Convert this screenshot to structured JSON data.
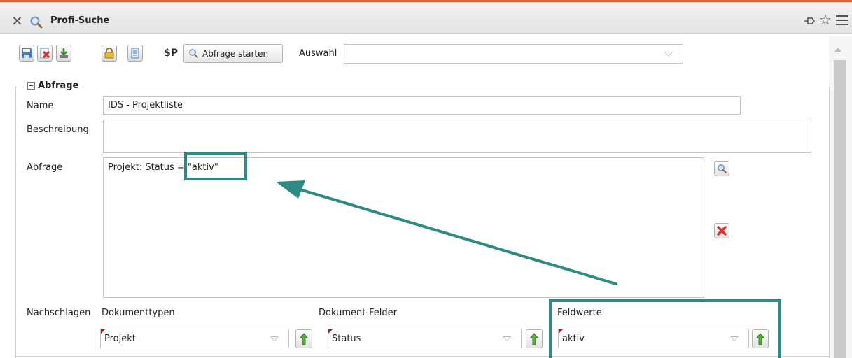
{
  "window": {
    "title": "Profi-Suche",
    "icons": [
      "close-icon",
      "search-icon",
      "pin-icon",
      "star-icon",
      "menu-icon"
    ]
  },
  "toolbar": {
    "dollar_label": "$P",
    "start_label": "Abfrage starten",
    "auswahl_label": "Auswahl",
    "auswahl_value": ""
  },
  "form": {
    "section_title": "Abfrage",
    "name_label": "Name",
    "name_value": "IDS - Projektliste",
    "description_label": "Beschreibung",
    "description_value": "",
    "query_label": "Abfrage",
    "query_value": "Projekt:  Status = \"aktiv\""
  },
  "lookup": {
    "label": "Nachschlagen",
    "doctypes_label": "Dokumenttypen",
    "doctypes_value": "Projekt",
    "docfields_label": "Dokument-Felder",
    "docfields_value": "Status",
    "fieldvalues_label": "Feldwerte",
    "fieldvalues_value": "aktiv"
  },
  "colors": {
    "accent": "#e0603a",
    "highlight": "#2e8a82",
    "delete_red": "#d9342b"
  }
}
